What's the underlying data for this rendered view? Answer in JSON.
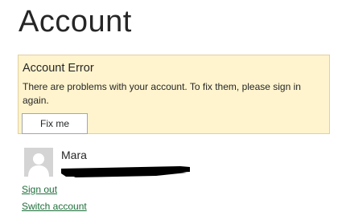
{
  "page": {
    "title": "Account"
  },
  "error": {
    "title": "Account Error",
    "message": "There are problems with your account. To fix them, please sign in again.",
    "button_label": "Fix me"
  },
  "user": {
    "name": "Mara",
    "avatar_icon": "person-placeholder-icon"
  },
  "links": {
    "sign_out": "Sign out",
    "switch_account": "Switch account"
  },
  "colors": {
    "error_background": "#fff4ce",
    "error_border": "#e3cf9a",
    "link": "#1e6e3a",
    "avatar_background": "#d4d4d4"
  }
}
